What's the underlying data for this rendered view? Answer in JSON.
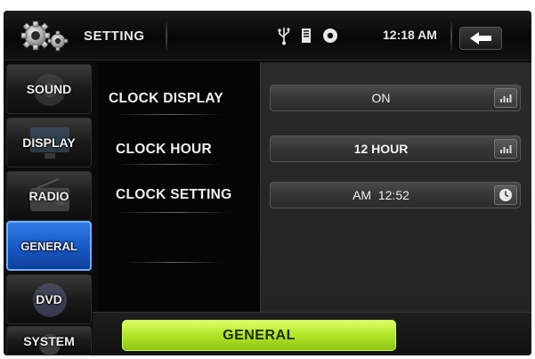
{
  "header": {
    "title": "SETTING",
    "time": "12:18 AM",
    "icons": [
      "gear-icon",
      "usb-icon",
      "sd-card-icon",
      "disc-icon",
      "back-arrow-icon"
    ]
  },
  "sidebar": {
    "items": [
      {
        "label": "SOUND",
        "icon": "speaker-icon"
      },
      {
        "label": "DISPLAY",
        "icon": "monitor-icon"
      },
      {
        "label": "RADIO",
        "icon": "radio-icon"
      },
      {
        "label": "GENERAL",
        "active": true
      },
      {
        "label": "DVD",
        "icon": "disc-icon"
      },
      {
        "label": "SYSTEM",
        "icon": "system-icon"
      }
    ]
  },
  "settings": {
    "clock_display": {
      "label": "CLOCK DISPLAY",
      "value": "ON"
    },
    "clock_hour": {
      "label": "CLOCK HOUR",
      "value": "12 HOUR"
    },
    "clock_setting": {
      "label": "CLOCK SETTING",
      "value": "AM  12:52"
    }
  },
  "footer": {
    "label": "GENERAL"
  },
  "colors": {
    "active": "#1758c4",
    "highlight": "#b4e82a"
  }
}
